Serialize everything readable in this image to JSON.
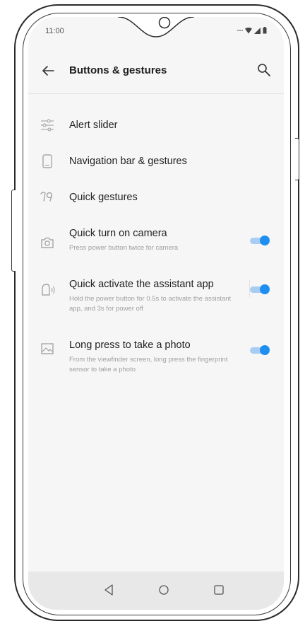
{
  "status_bar": {
    "time": "11:00",
    "icons": [
      "more-dots-icon",
      "wifi-icon",
      "signal-icon",
      "battery-icon"
    ]
  },
  "header": {
    "title": "Buttons & gestures",
    "back_icon": "arrow-left-icon",
    "search_icon": "search-icon"
  },
  "settings": [
    {
      "id": "alert-slider",
      "icon": "sliders-icon",
      "title": "Alert slider"
    },
    {
      "id": "navigation-bar",
      "icon": "phone-outline-icon",
      "title": "Navigation bar & gestures"
    },
    {
      "id": "quick-gestures",
      "icon": "gesture-icon",
      "title": "Quick gestures"
    },
    {
      "id": "quick-camera",
      "icon": "camera-icon",
      "title": "Quick turn on camera",
      "subtitle": "Press power button twice for camera",
      "toggle": true
    },
    {
      "id": "quick-assistant",
      "icon": "assistant-icon",
      "title": "Quick activate the assistant app",
      "subtitle": "Hold the power button for 0.5s to activate the assistant app, and 3s for power off",
      "toggle": true
    },
    {
      "id": "long-press-photo",
      "icon": "image-icon",
      "title": "Long press to take a photo",
      "subtitle": "From the viewfinder screen, long press the fingerprint sensor to take a photo",
      "toggle": true
    }
  ],
  "nav_bar": {
    "buttons": [
      "back-triangle-icon",
      "home-circle-icon",
      "recents-square-icon"
    ]
  },
  "colors": {
    "accent": "#1e8ef0",
    "accent_track": "#a8ccf2",
    "background": "#f6f6f6",
    "nav_bar": "#e8e8e8"
  }
}
